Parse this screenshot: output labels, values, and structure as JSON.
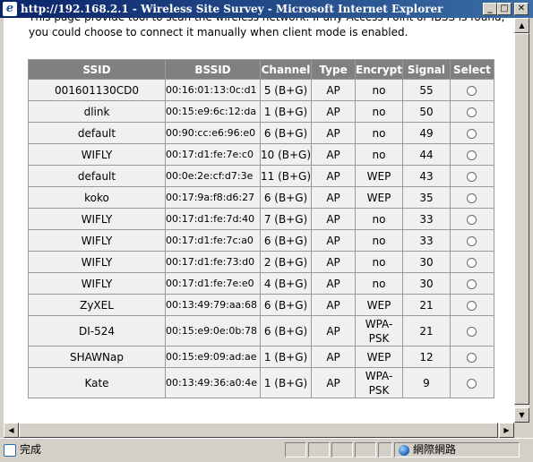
{
  "window": {
    "title": "http://192.168.2.1 - Wireless Site Survey - Microsoft Internet Explorer",
    "ie_icon": "ie-logo-icon",
    "minimize_glyph": "_",
    "maximize_glyph": "□",
    "close_glyph": "✕"
  },
  "intro_text": "This page provide tool to scan the wireless network. If any Access Point or IBSS is found, you could choose to connect it manually when client mode is enabled.",
  "table": {
    "headers": [
      "SSID",
      "BSSID",
      "Channel",
      "Type",
      "Encrypt",
      "Signal",
      "Select"
    ],
    "rows": [
      {
        "ssid": "001601130CD0",
        "bssid": "00:16:01:13:0c:d1",
        "channel": "5 (B+G)",
        "type": "AP",
        "encrypt": "no",
        "signal": "55"
      },
      {
        "ssid": "dlink",
        "bssid": "00:15:e9:6c:12:da",
        "channel": "1 (B+G)",
        "type": "AP",
        "encrypt": "no",
        "signal": "50"
      },
      {
        "ssid": "default",
        "bssid": "00:90:cc:e6:96:e0",
        "channel": "6 (B+G)",
        "type": "AP",
        "encrypt": "no",
        "signal": "49"
      },
      {
        "ssid": "WIFLY",
        "bssid": "00:17:d1:fe:7e:c0",
        "channel": "10 (B+G)",
        "type": "AP",
        "encrypt": "no",
        "signal": "44"
      },
      {
        "ssid": "default",
        "bssid": "00:0e:2e:cf:d7:3e",
        "channel": "11 (B+G)",
        "type": "AP",
        "encrypt": "WEP",
        "signal": "43"
      },
      {
        "ssid": "koko",
        "bssid": "00:17:9a:f8:d6:27",
        "channel": "6 (B+G)",
        "type": "AP",
        "encrypt": "WEP",
        "signal": "35"
      },
      {
        "ssid": "WIFLY",
        "bssid": "00:17:d1:fe:7d:40",
        "channel": "7 (B+G)",
        "type": "AP",
        "encrypt": "no",
        "signal": "33"
      },
      {
        "ssid": "WIFLY",
        "bssid": "00:17:d1:fe:7c:a0",
        "channel": "6 (B+G)",
        "type": "AP",
        "encrypt": "no",
        "signal": "33"
      },
      {
        "ssid": "WIFLY",
        "bssid": "00:17:d1:fe:73:d0",
        "channel": "2 (B+G)",
        "type": "AP",
        "encrypt": "no",
        "signal": "30"
      },
      {
        "ssid": "WIFLY",
        "bssid": "00:17:d1:fe:7e:e0",
        "channel": "4 (B+G)",
        "type": "AP",
        "encrypt": "no",
        "signal": "30"
      },
      {
        "ssid": "ZyXEL",
        "bssid": "00:13:49:79:aa:68",
        "channel": "6 (B+G)",
        "type": "AP",
        "encrypt": "WEP",
        "signal": "21"
      },
      {
        "ssid": "DI-524",
        "bssid": "00:15:e9:0e:0b:78",
        "channel": "6 (B+G)",
        "type": "AP",
        "encrypt": "WPA-PSK",
        "signal": "21"
      },
      {
        "ssid": "SHAWNap",
        "bssid": "00:15:e9:09:ad:ae",
        "channel": "1 (B+G)",
        "type": "AP",
        "encrypt": "WEP",
        "signal": "12"
      },
      {
        "ssid": "Kate",
        "bssid": "00:13:49:36:a0:4e",
        "channel": "1 (B+G)",
        "type": "AP",
        "encrypt": "WPA-PSK",
        "signal": "9"
      }
    ]
  },
  "scrollbars": {
    "up_glyph": "▲",
    "down_glyph": "▼",
    "left_glyph": "◀",
    "right_glyph": "▶"
  },
  "status": {
    "text": "完成",
    "zone": "網際網路",
    "page_icon": "page-icon",
    "zone_icon": "globe-icon"
  },
  "colors": {
    "title_bar": "#0a246a",
    "header_bg": "#808080",
    "cell_bg": "#f0f0f0"
  }
}
